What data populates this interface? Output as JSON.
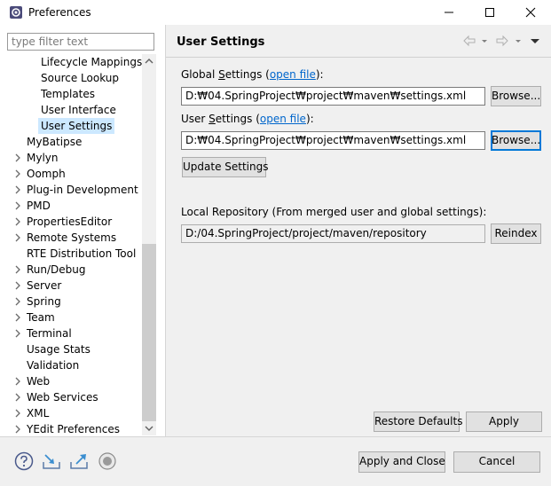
{
  "window": {
    "title": "Preferences"
  },
  "filter": {
    "placeholder": "type filter text"
  },
  "tree": {
    "items": [
      {
        "label": "Lifecycle Mappings",
        "level": 2,
        "expandable": false,
        "selected": false
      },
      {
        "label": "Source Lookup",
        "level": 2,
        "expandable": false,
        "selected": false
      },
      {
        "label": "Templates",
        "level": 2,
        "expandable": false,
        "selected": false
      },
      {
        "label": "User Interface",
        "level": 2,
        "expandable": false,
        "selected": false
      },
      {
        "label": "User Settings",
        "level": 2,
        "expandable": false,
        "selected": true
      },
      {
        "label": "MyBatipse",
        "level": 1,
        "expandable": false,
        "selected": false
      },
      {
        "label": "Mylyn",
        "level": 1,
        "expandable": true,
        "selected": false
      },
      {
        "label": "Oomph",
        "level": 1,
        "expandable": true,
        "selected": false
      },
      {
        "label": "Plug-in Development",
        "level": 1,
        "expandable": true,
        "selected": false
      },
      {
        "label": "PMD",
        "level": 1,
        "expandable": true,
        "selected": false
      },
      {
        "label": "PropertiesEditor",
        "level": 1,
        "expandable": true,
        "selected": false
      },
      {
        "label": "Remote Systems",
        "level": 1,
        "expandable": true,
        "selected": false
      },
      {
        "label": "RTE Distribution Tool",
        "level": 1,
        "expandable": false,
        "selected": false
      },
      {
        "label": "Run/Debug",
        "level": 1,
        "expandable": true,
        "selected": false
      },
      {
        "label": "Server",
        "level": 1,
        "expandable": true,
        "selected": false
      },
      {
        "label": "Spring",
        "level": 1,
        "expandable": true,
        "selected": false
      },
      {
        "label": "Team",
        "level": 1,
        "expandable": true,
        "selected": false
      },
      {
        "label": "Terminal",
        "level": 1,
        "expandable": true,
        "selected": false
      },
      {
        "label": "Usage Stats",
        "level": 1,
        "expandable": false,
        "selected": false
      },
      {
        "label": "Validation",
        "level": 1,
        "expandable": false,
        "selected": false
      },
      {
        "label": "Web",
        "level": 1,
        "expandable": true,
        "selected": false
      },
      {
        "label": "Web Services",
        "level": 1,
        "expandable": true,
        "selected": false
      },
      {
        "label": "XML",
        "level": 1,
        "expandable": true,
        "selected": false
      },
      {
        "label": "YEdit Preferences",
        "level": 1,
        "expandable": true,
        "selected": false
      }
    ]
  },
  "page": {
    "title": "User Settings",
    "global": {
      "label_prefix": "Global ",
      "label_accel": "S",
      "label_rest": "ettings (",
      "link": "open file",
      "label_suffix": "):",
      "value": "D:₩04.SpringProject₩project₩maven₩settings.xml",
      "browse": "Browse..."
    },
    "user": {
      "label_prefix": "User ",
      "label_accel": "S",
      "label_rest": "ettings (",
      "link": "open file",
      "label_suffix": "):",
      "value": "D:₩04.SpringProject₩project₩maven₩settings.xml",
      "browse": "Browse..."
    },
    "update_button": "Update Settings",
    "local_repo_label": "Local Repository (From merged user and global settings):",
    "local_repo_value": "D:/04.SpringProject/project/maven/repository",
    "reindex_button": "Reindex",
    "restore_defaults": "Restore Defaults",
    "apply": "Apply"
  },
  "footer": {
    "apply_close": "Apply and Close",
    "cancel": "Cancel"
  },
  "icons": {
    "help": "help-icon",
    "import": "import-icon",
    "export": "export-icon",
    "record": "record-icon"
  },
  "colors": {
    "selection": "#cce8ff",
    "link": "#0066cc",
    "focus": "#0078d7"
  }
}
